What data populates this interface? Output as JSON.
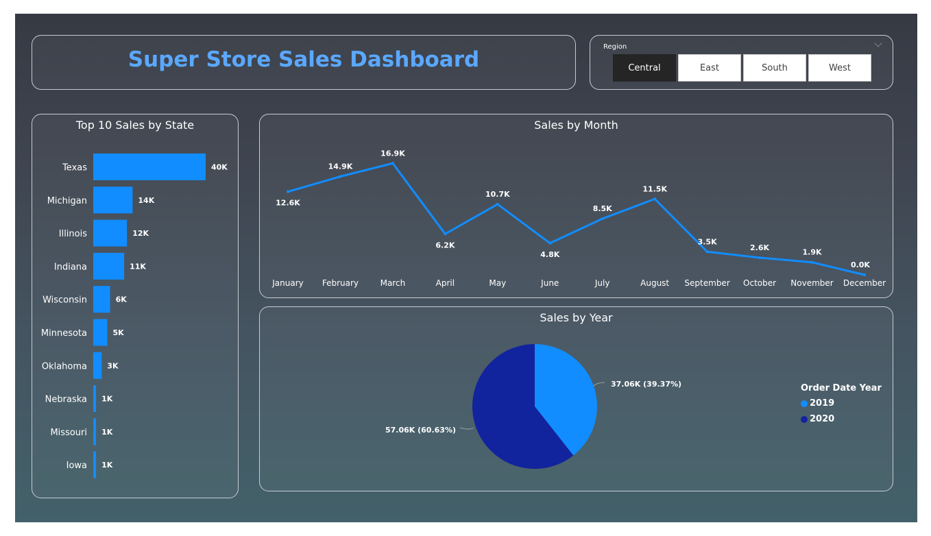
{
  "dashboard": {
    "title": "Super Store Sales Dashboard"
  },
  "slicer": {
    "label": "Region",
    "options": [
      "Central",
      "East",
      "South",
      "West"
    ],
    "selected": "Central"
  },
  "colors": {
    "title": "#5aa8ff",
    "bar": "#118dff",
    "line": "#118dff",
    "pie_2019": "#118dff",
    "pie_2020": "#12239e"
  },
  "chart_data": [
    {
      "type": "bar",
      "orientation": "horizontal",
      "title": "Top 10 Sales by State",
      "categories": [
        "Texas",
        "Michigan",
        "Illinois",
        "Indiana",
        "Wisconsin",
        "Minnesota",
        "Oklahoma",
        "Nebraska",
        "Missouri",
        "Iowa"
      ],
      "values": [
        40,
        14,
        12,
        11,
        6,
        5,
        3,
        1,
        1,
        1
      ],
      "data_labels": [
        "40K",
        "14K",
        "12K",
        "11K",
        "6K",
        "5K",
        "3K",
        "1K",
        "1K",
        "1K"
      ]
    },
    {
      "type": "line",
      "title": "Sales by Month",
      "categories": [
        "January",
        "February",
        "March",
        "April",
        "May",
        "June",
        "July",
        "August",
        "September",
        "October",
        "November",
        "December"
      ],
      "values": [
        12.6,
        14.9,
        16.9,
        6.2,
        10.7,
        4.8,
        8.5,
        11.5,
        3.5,
        2.6,
        1.9,
        0.0
      ],
      "data_labels": [
        "12.6K",
        "14.9K",
        "16.9K",
        "6.2K",
        "10.7K",
        "4.8K",
        "8.5K",
        "11.5K",
        "3.5K",
        "2.6K",
        "1.9K",
        "0.0K"
      ]
    },
    {
      "type": "pie",
      "title": "Sales by Year",
      "legend_title": "Order Date Year",
      "legend_position": "right",
      "slices": [
        {
          "name": "2019",
          "value": 37.06,
          "percent": 39.37,
          "label": "37.06K (39.37%)"
        },
        {
          "name": "2020",
          "value": 57.06,
          "percent": 60.63,
          "label": "57.06K (60.63%)"
        }
      ]
    }
  ]
}
